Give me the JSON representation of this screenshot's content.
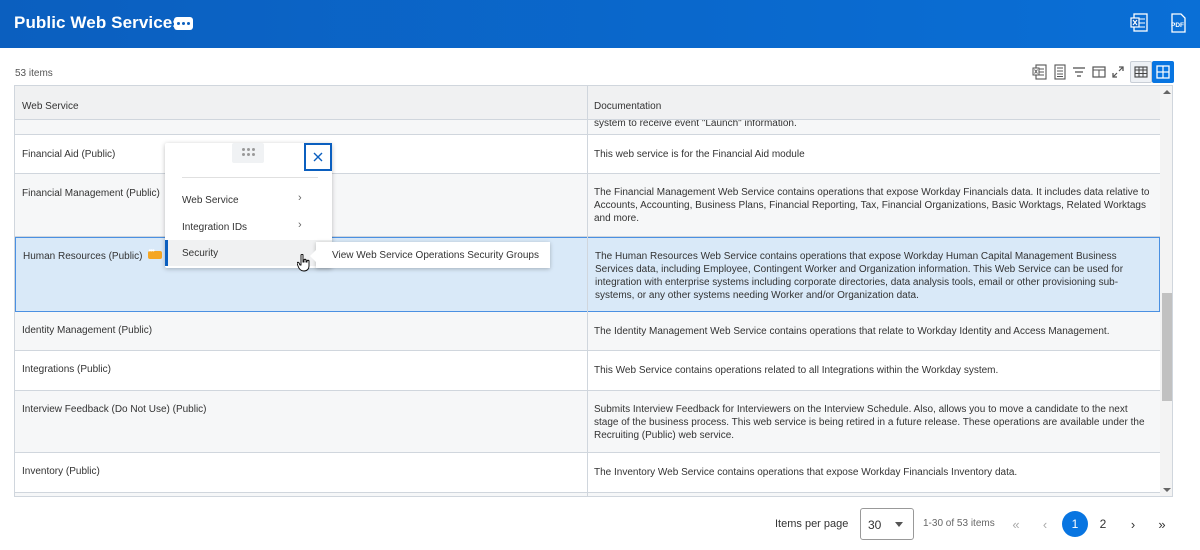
{
  "header": {
    "title": "Public Web Services",
    "related_actions_icon": "more-dots-icon",
    "export_excel_icon": "excel-icon",
    "export_pdf_icon": "pdf-icon",
    "pdf_label": "PDF"
  },
  "grid": {
    "item_count": "53 items",
    "toolbar_icons": [
      "excel-export-icon",
      "print-icon",
      "filter-icon",
      "columns-icon",
      "fullscreen-icon",
      "table-view-icon",
      "grid-view-icon"
    ],
    "columns": [
      "Web Service",
      "Documentation"
    ],
    "partial_top_text": "system to receive event \"Launch\" information.",
    "rows": [
      {
        "service": "Financial Aid (Public)",
        "doc": "This web service is for the Financial Aid module"
      },
      {
        "service": "Financial Management (Public)",
        "doc": "The Financial Management Web Service contains operations that expose Workday Financials data. It includes data relative to Accounts, Accounting, Business Plans, Financial Reporting, Tax, Financial Organizations, Basic Worktags, Related Worktags and more."
      },
      {
        "service": "Human Resources (Public)",
        "doc": "The Human Resources Web Service contains operations that expose Workday Human Capital Management Business Services data, including Employee, Contingent Worker and Organization information. This Web Service can be used for integration with enterprise systems including corporate directories, data analysis tools, email or other provisioning sub-systems, or any other systems needing Worker and/or Organization data."
      },
      {
        "service": "Identity Management (Public)",
        "doc": "The Identity Management Web Service contains operations that relate to Workday Identity and Access Management."
      },
      {
        "service": "Integrations (Public)",
        "doc": "This Web Service contains operations related to all Integrations within the Workday system."
      },
      {
        "service": "Interview Feedback (Do Not Use) (Public)",
        "doc": "Submits Interview Feedback for Interviewers on the Interview Schedule. Also, allows you to move a candidate to the next stage of the business process. This web service is being retired in a future release. These operations are available under the Recruiting (Public) web service."
      },
      {
        "service": "Inventory (Public)",
        "doc": "The Inventory Web Service contains operations that expose Workday Financials Inventory data."
      }
    ]
  },
  "popup": {
    "items": [
      {
        "label": "Web Service"
      },
      {
        "label": "Integration IDs"
      },
      {
        "label": "Security"
      }
    ],
    "flyout": "View Web Service Operations Security Groups"
  },
  "pager": {
    "items_per_page_label": "Items per page",
    "items_per_page_value": "30",
    "range_text": "1-30 of 53 items",
    "pages": [
      "1",
      "2"
    ],
    "current_page": "1"
  },
  "colors": {
    "header_blue": "#0b5fbf",
    "accent": "#0875e1",
    "selected_row": "#d9e9f8",
    "badge_orange": "#f5a623"
  }
}
